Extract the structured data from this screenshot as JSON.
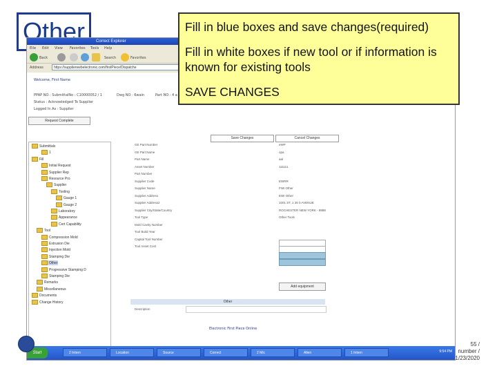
{
  "slide": {
    "title": "Other",
    "callout": {
      "line1": "Fill in blue boxes and save changes(required)",
      "line2": "Fill in white boxes if new tool or if information is known for existing tools",
      "line3": "SAVE CHANGES"
    },
    "footer": {
      "page": "55 /",
      "label": "number /",
      "date": "1/23/2020"
    }
  },
  "browser": {
    "title": "Correct Explorer",
    "menu": [
      "Eile",
      "Edit",
      "View",
      "Favorites",
      "Tools",
      "Help"
    ],
    "toolbar": [
      "Back",
      "Search",
      "Favorites"
    ],
    "address": "https://supplierwebelectronic.com/firstPiece/Dispatche",
    "welcome": "Welcome, First Name",
    "info": {
      "ppap_no": "PPAP NO : SubmittalNo : C10000052 / 1",
      "dwg_no": "Dwg NO : 6wain",
      "part_no": "Part NO : 4 a",
      "status": "Status : Acknowledged To Supplier",
      "logged_in_as": "Logged In As : Supplier"
    },
    "request_button": "Request Complete"
  },
  "tree": {
    "items": [
      "Submittals",
      "1",
      "Fill",
      "Initial Request",
      "Supplier Rep",
      "Resource Pro",
      "Supplier",
      "Tooling",
      "Gauge 1",
      "Gauge 2",
      "Laboratory",
      "Appearance",
      "Cert Capability",
      "Tool",
      "Compression Mold",
      "Extrusion Die",
      "Injection Mold",
      "Stamping Die",
      "Other",
      "Progressive Stamping D",
      "Stamping Die",
      "Remarks",
      "Miscellaneous",
      "Documents",
      "Change History"
    ],
    "selected_index": 18
  },
  "form": {
    "save_label": "Save Changes",
    "cancel_label": "Cancel Changes",
    "rows": [
      {
        "label": "GE Part Number",
        "value": "eWP"
      },
      {
        "label": "GE Part Name",
        "value": "opa"
      },
      {
        "label": "Part Name",
        "value": "aal"
      },
      {
        "label": "Asset Number",
        "value": "111111"
      },
      {
        "label": "Part Number",
        "value": ""
      },
      {
        "label": "Supplier Code",
        "value": "EWRR"
      },
      {
        "label": "Supplier Name",
        "value": "FWI Other"
      },
      {
        "label": "Supplier Address",
        "value": "EWI Other"
      },
      {
        "label": "Supplier Address2",
        "value": "1001 ST, 1 26 0 AVENUE"
      },
      {
        "label": "Supplier City/State/Country",
        "value": "ROCHESTER NEW YORK - 8888"
      },
      {
        "label": "Tool Type",
        "value": "Other Tools"
      },
      {
        "label": "Mold Cavity Number",
        "value": ""
      },
      {
        "label": "Tool Build Year",
        "value": ""
      },
      {
        "label": "Capital Tool Number",
        "value": ""
      },
      {
        "label": "Tool Asset Cost",
        "value": ""
      }
    ],
    "add_equipment_label": "Add equipment",
    "section_header": "Other",
    "description_label": "Description",
    "footer_text": "Electronic First Piece Online"
  },
  "taskbar": {
    "start": "Start",
    "tasks": [
      "2 Intern",
      "Location",
      "Source",
      "Correct",
      "2 Mic",
      "Alien",
      "1 Intern"
    ],
    "clock": "9:54 PM"
  },
  "colors": {
    "callout_bg": "#ffff99",
    "blue_box": "#9fc5dc",
    "title_border": "#1f3a8a"
  }
}
